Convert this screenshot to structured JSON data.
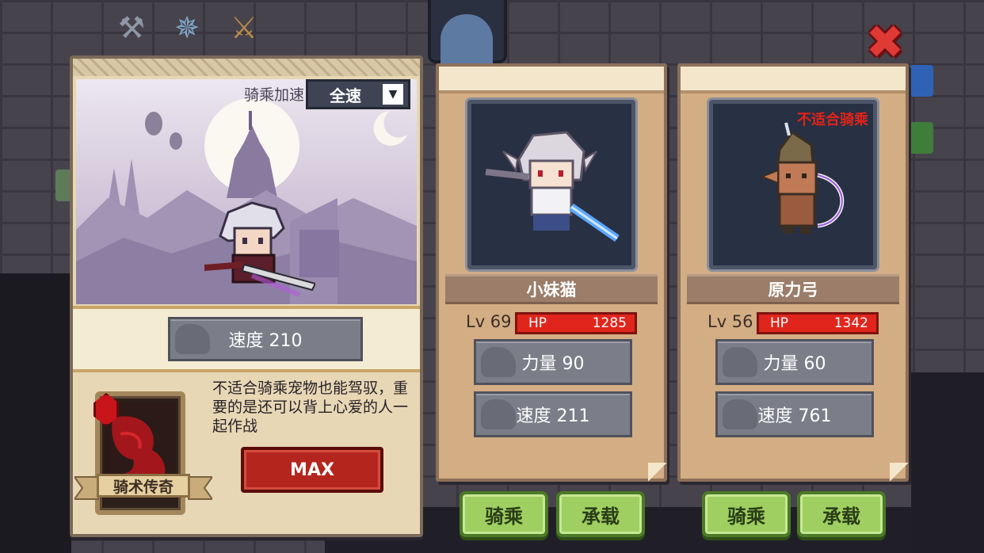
{
  "top_icons": [
    {
      "icon": "hammer-icon",
      "glyph": "⚒"
    },
    {
      "icon": "shuriken-icon",
      "glyph": "✵"
    },
    {
      "icon": "axe-icon",
      "glyph": "⚔"
    }
  ],
  "close": {
    "glyph": "✖",
    "icon": "close-icon"
  },
  "left_panel": {
    "ride_speed_label": "骑乘加速",
    "ride_speed_value": "全速",
    "speed_stat": "速度 210",
    "description": "不适合骑乘宠物也能驾驭，重要的是还可以背上心爱的人一起作战",
    "max_button": "MAX",
    "skill_name": "骑术传奇"
  },
  "mounts": [
    {
      "name": "小妹猫",
      "level": "Lv 69",
      "hp_label": "HP",
      "hp_value": "1285",
      "power": "力量 90",
      "speed": "速度 211",
      "note": "",
      "ride_button": "骑乘",
      "carry_button": "承载"
    },
    {
      "name": "原力弓",
      "level": "Lv 56",
      "hp_label": "HP",
      "hp_value": "1342",
      "power": "力量 60",
      "speed": "速度 761",
      "note": "不适合骑乘",
      "ride_button": "骑乘",
      "carry_button": "承载"
    }
  ],
  "colors": {
    "accent_red": "#e0261c",
    "button_green": "#9fcf61",
    "panel_tan": "#d3ad84",
    "warning_text": "#e2231a"
  }
}
